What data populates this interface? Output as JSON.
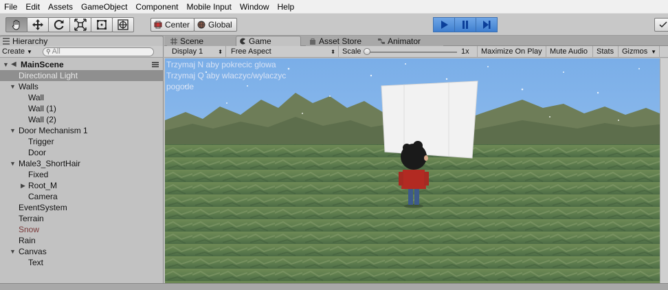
{
  "menu": [
    "File",
    "Edit",
    "Assets",
    "GameObject",
    "Component",
    "Mobile Input",
    "Window",
    "Help"
  ],
  "toolbar": {
    "tools": [
      "hand-tool",
      "move-tool",
      "rotate-tool",
      "scale-tool",
      "rect-tool",
      "transform-tool"
    ],
    "pivot_label": "Center",
    "space_label": "Global",
    "playback": [
      "play",
      "pause",
      "step"
    ],
    "accent": "#3f7fd0"
  },
  "hierarchy": {
    "tab_label": "Hierarchy",
    "create_label": "Create",
    "search_placeholder": "All",
    "items": [
      {
        "label": "MainScene",
        "depth": 0,
        "fold": "open",
        "scene": true
      },
      {
        "label": "Directional Light",
        "depth": 1,
        "selected": true
      },
      {
        "label": "Walls",
        "depth": 1,
        "fold": "open"
      },
      {
        "label": "Wall",
        "depth": 2
      },
      {
        "label": "Wall (1)",
        "depth": 2
      },
      {
        "label": "Wall (2)",
        "depth": 2
      },
      {
        "label": "Door Mechanism 1",
        "depth": 1,
        "fold": "open"
      },
      {
        "label": "Trigger",
        "depth": 2
      },
      {
        "label": "Door",
        "depth": 2
      },
      {
        "label": "Male3_ShortHair",
        "depth": 1,
        "fold": "open"
      },
      {
        "label": "Fixed",
        "depth": 2
      },
      {
        "label": "Root_M",
        "depth": 2,
        "fold": "closed"
      },
      {
        "label": "Camera",
        "depth": 2
      },
      {
        "label": "EventSystem",
        "depth": 1
      },
      {
        "label": "Terrain",
        "depth": 1
      },
      {
        "label": "Snow",
        "depth": 1,
        "disabled": true
      },
      {
        "label": "Rain",
        "depth": 1
      },
      {
        "label": "Canvas",
        "depth": 1,
        "fold": "open"
      },
      {
        "label": "Text",
        "depth": 2
      }
    ]
  },
  "tabs": {
    "scene": "Scene",
    "game": "Game",
    "asset_store": "Asset Store",
    "animator": "Animator"
  },
  "game_toolbar": {
    "display": "Display 1",
    "aspect": "Free Aspect",
    "scale_label": "Scale",
    "scale_value": "1x",
    "maximize": "Maximize On Play",
    "mute": "Mute Audio",
    "stats": "Stats",
    "gizmos": "Gizmos"
  },
  "game_view": {
    "overlay_lines": [
      "Trzymaj N aby pokrecic glowa",
      "Trzymaj Q aby wlaczyc/wylaczyc",
      "pogode"
    ]
  }
}
